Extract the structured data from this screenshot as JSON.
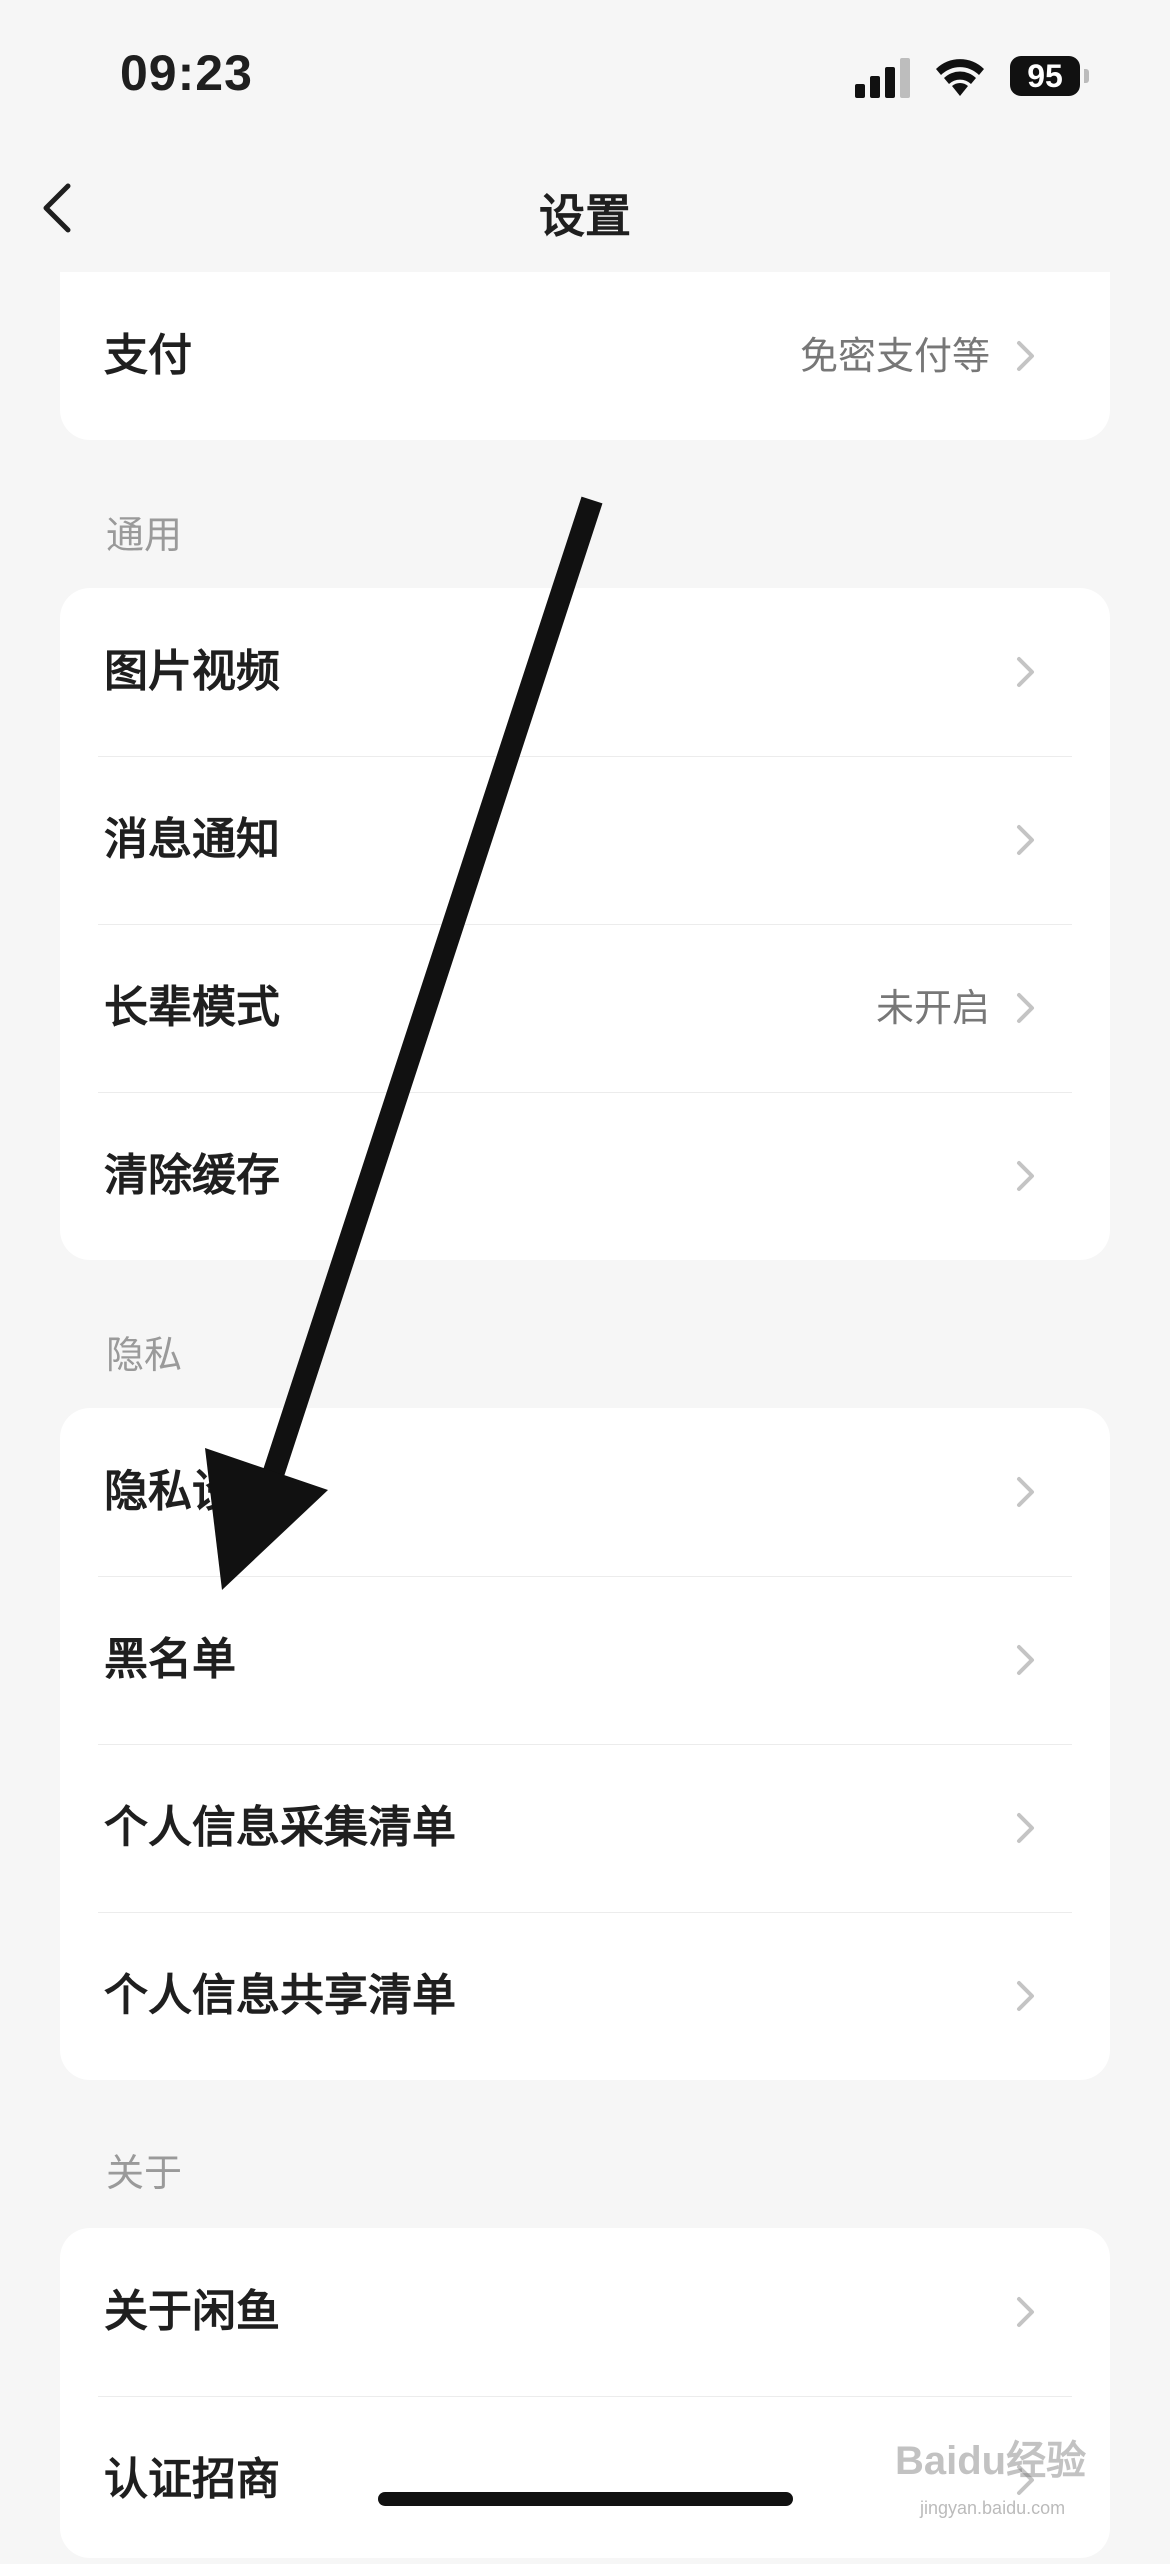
{
  "status_bar": {
    "time": "09:23",
    "battery": "95",
    "signal_icon": "cellular-signal-icon",
    "wifi_icon": "wifi-icon"
  },
  "nav": {
    "title": "设置",
    "back_icon": "chevron-left-icon"
  },
  "payment": {
    "label": "支付",
    "value": "免密支付等"
  },
  "sections": {
    "general": {
      "header": "通用",
      "items": [
        {
          "label": "图片视频",
          "value": ""
        },
        {
          "label": "消息通知",
          "value": ""
        },
        {
          "label": "长辈模式",
          "value": "未开启"
        },
        {
          "label": "清除缓存",
          "value": ""
        }
      ]
    },
    "privacy": {
      "header": "隐私",
      "items": [
        {
          "label": "隐私设置",
          "value": ""
        },
        {
          "label": "黑名单",
          "value": ""
        },
        {
          "label": "个人信息采集清单",
          "value": ""
        },
        {
          "label": "个人信息共享清单",
          "value": ""
        }
      ]
    },
    "about": {
      "header": "关于",
      "items": [
        {
          "label": "关于闲鱼",
          "value": ""
        },
        {
          "label": "认证招商",
          "value": ""
        }
      ]
    }
  },
  "annotation": {
    "arrow_color": "#111111"
  },
  "watermark": {
    "text": "Baidu经验",
    "sub": "jingyan.baidu.com"
  },
  "colors": {
    "background": "#f6f6f6",
    "card": "#ffffff",
    "secondary_text": "#777777"
  }
}
